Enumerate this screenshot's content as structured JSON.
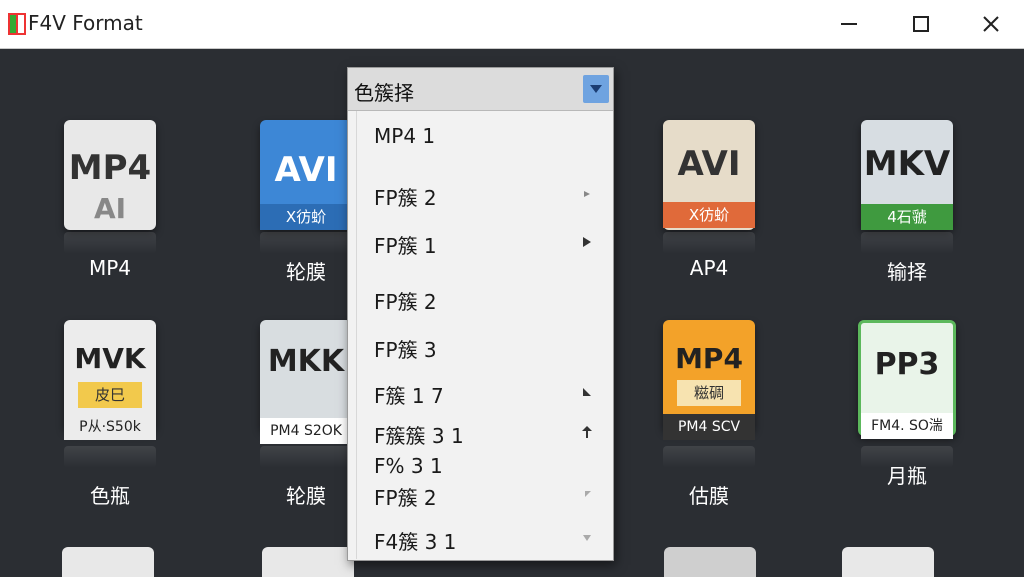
{
  "window": {
    "title": "F4V Format",
    "controls": [
      "minimize",
      "maximize",
      "close"
    ]
  },
  "dropdown": {
    "header": "色簇择",
    "items": [
      {
        "label": "MP4 1",
        "arrow": ""
      },
      {
        "label": "FP簇 2",
        "arrow": "right-small"
      },
      {
        "label": "FP簇 1",
        "arrow": "right"
      },
      {
        "label": "FP簇 2",
        "arrow": ""
      },
      {
        "label": "FP簇 3",
        "arrow": ""
      },
      {
        "label": "F簇 1 7",
        "arrow": "right-corner"
      },
      {
        "label": "F簇簇 3 1",
        "arrow": "up"
      },
      {
        "label": "F% 3 1",
        "arrow": ""
      },
      {
        "label": "FP簇 2",
        "arrow": "diag"
      },
      {
        "label": "F4簇 3 1",
        "arrow": "down"
      }
    ]
  },
  "tiles": [
    {
      "format": "MP4",
      "sub": "AI",
      "band": "",
      "caption": "MP4",
      "color": "#e8e8e8",
      "icon": "mp4-file-icon"
    },
    {
      "format": "AVI",
      "sub": "",
      "band": "X彷蚧",
      "caption": "轮膜",
      "color": "#3d87d6",
      "icon": "avi-file-icon"
    },
    {
      "format": "AVI",
      "sub": "",
      "band": "X彷蚧",
      "caption": "AP4",
      "color": "#e6dcc9",
      "icon": "avi-landscape-file-icon"
    },
    {
      "format": "MKV",
      "sub": "",
      "band": "4石虢",
      "caption": "输择",
      "color": "#d7dde2",
      "icon": "mkv-file-icon"
    },
    {
      "format": "MVK",
      "sub": "皮巳",
      "band": "P从·S50k",
      "caption": "色瓶",
      "color": "#ececec",
      "icon": "mvk-file-icon"
    },
    {
      "format": "MKK",
      "sub": "",
      "band": "PM4 S2OK",
      "caption": "轮膜",
      "color": "#d8dde0",
      "icon": "mkk-file-icon"
    },
    {
      "format": "MP4",
      "sub": "糍碉",
      "band": "PM4 SCV",
      "caption": "估膜",
      "color": "#f3a229",
      "icon": "mp4-orange-file-icon"
    },
    {
      "format": "PP3",
      "sub": "",
      "band": "FM4. SO湍",
      "caption": "月瓶",
      "color": "#5cb85c",
      "icon": "pp3-file-icon"
    }
  ]
}
